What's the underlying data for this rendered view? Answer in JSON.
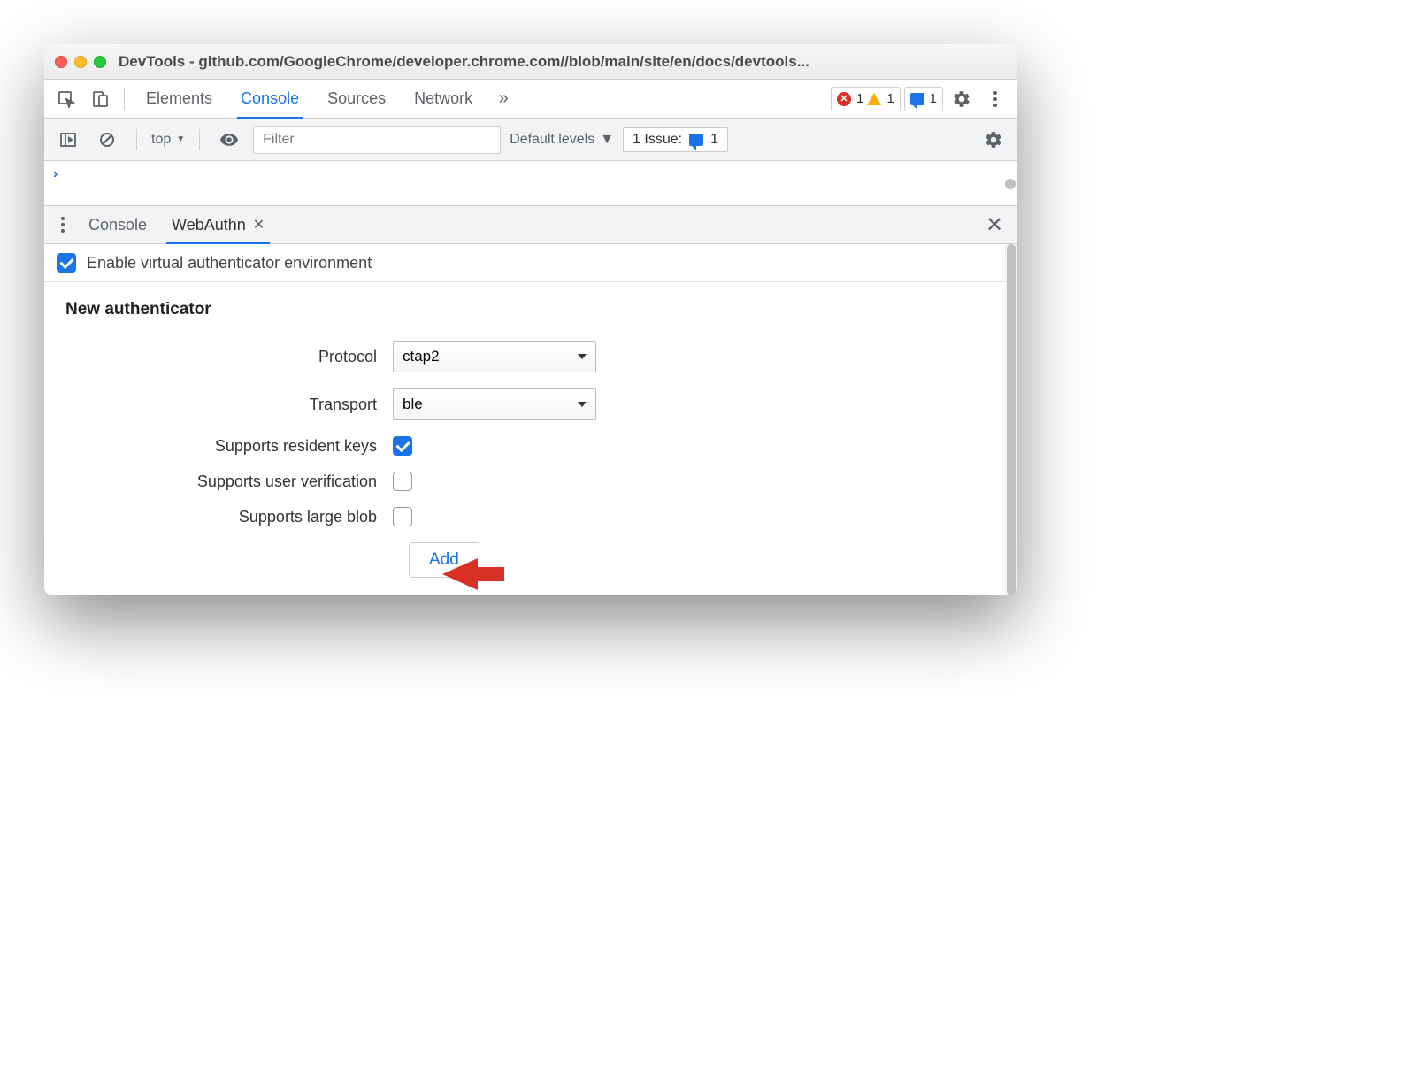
{
  "window": {
    "title": "DevTools - github.com/GoogleChrome/developer.chrome.com//blob/main/site/en/docs/devtools..."
  },
  "tabs": {
    "elements": "Elements",
    "console": "Console",
    "sources": "Sources",
    "network": "Network"
  },
  "status": {
    "errors": "1",
    "warnings": "1",
    "issues": "1"
  },
  "console_toolbar": {
    "context": "top",
    "filter_placeholder": "Filter",
    "levels": "Default levels",
    "issue_label": "1 Issue:",
    "issue_count": "1"
  },
  "drawer": {
    "console": "Console",
    "webauthn": "WebAuthn"
  },
  "webauthn": {
    "enable_label": "Enable virtual authenticator environment",
    "enable_checked": true,
    "section_title": "New authenticator",
    "protocol_label": "Protocol",
    "protocol_value": "ctap2",
    "transport_label": "Transport",
    "transport_value": "ble",
    "resident_keys_label": "Supports resident keys",
    "resident_keys_checked": true,
    "user_verification_label": "Supports user verification",
    "user_verification_checked": false,
    "large_blob_label": "Supports large blob",
    "large_blob_checked": false,
    "add_button": "Add"
  }
}
